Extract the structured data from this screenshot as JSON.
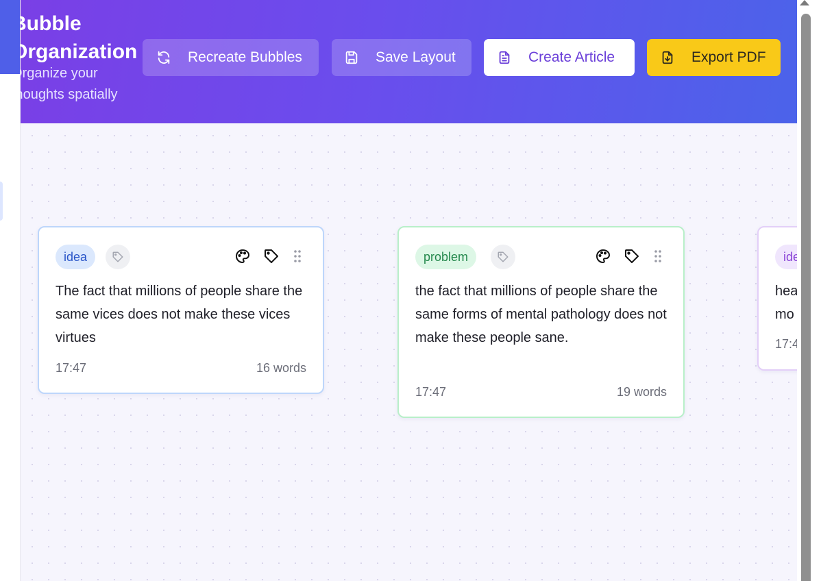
{
  "header": {
    "title": "Bubble\nOrganization",
    "subtitle": "Organize your\nthoughts spatially",
    "buttons": {
      "recreate": "Recreate Bubbles",
      "save": "Save Layout",
      "article": "Create Article",
      "export": "Export PDF"
    }
  },
  "bubbles": [
    {
      "tag": "idea",
      "text": "The fact that millions of people share the same vices does not make these vices virtues",
      "time": "17:47",
      "words": "16 words",
      "border_color": "#bdd6fb"
    },
    {
      "tag": "problem",
      "text": "the fact that millions of people share the same forms of mental pathology does not make these people sane.",
      "time": "17:47",
      "words": "19 words",
      "border_color": "#b8efc9"
    },
    {
      "tag": "ide",
      "text": "hea mo",
      "time": "17:4",
      "border_color": "#e3cff8"
    }
  ],
  "colors": {
    "header_gradient_start": "#7a3fe6",
    "header_gradient_end": "#4b63ea",
    "export_button": "#f9c918",
    "article_text": "#6b3fd9"
  },
  "icons": {
    "recreate": "refresh-icon",
    "save": "save-icon",
    "article": "document-icon",
    "export": "file-download-icon",
    "palette": "palette-icon",
    "tag": "tag-icon",
    "drag": "drag-handle-icon"
  }
}
